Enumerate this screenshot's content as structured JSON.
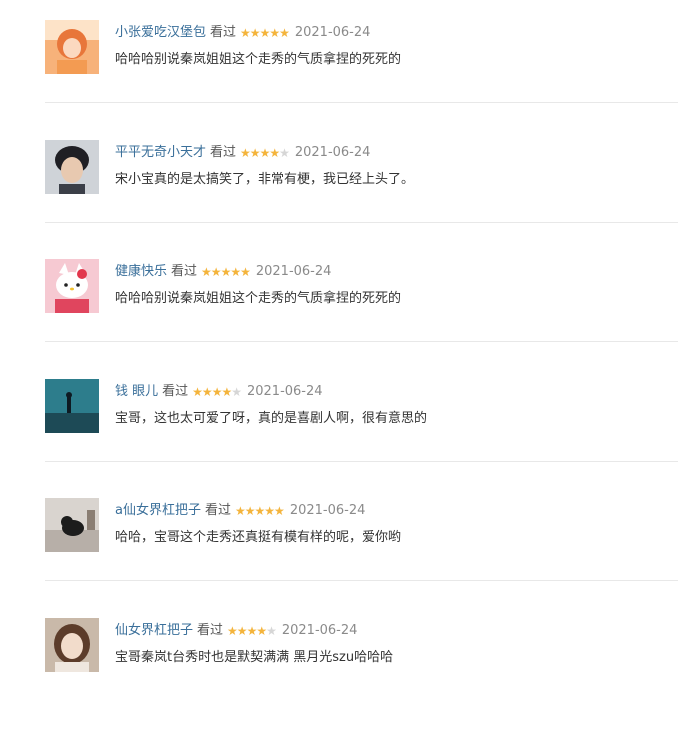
{
  "reviews": [
    {
      "username": "小张爱吃汉堡包",
      "action": "看过",
      "rating": 5,
      "date": "2021-06-24",
      "comment": "哈哈哈别说秦岚姐姐这个走秀的气质拿捏的死死的",
      "avatar": "orange-hair-girl"
    },
    {
      "username": "平平无奇小天才",
      "action": "看过",
      "rating": 4,
      "date": "2021-06-24",
      "comment": "宋小宝真的是太搞笑了，非常有梗，我已经上头了。",
      "avatar": "dark-hair-boy"
    },
    {
      "username": "健康快乐",
      "action": "看过",
      "rating": 5,
      "date": "2021-06-24",
      "comment": "哈哈哈别说秦岚姐姐这个走秀的气质拿捏的死死的",
      "avatar": "hello-kitty"
    },
    {
      "username": "钱 眼儿",
      "action": "看过",
      "rating": 4,
      "date": "2021-06-24",
      "comment": "宝哥，这也太可爱了呀，真的是喜剧人啊，很有意思的",
      "avatar": "teal-landscape"
    },
    {
      "username": "a仙女界杠把子",
      "action": "看过",
      "rating": 5,
      "date": "2021-06-24",
      "comment": "哈哈，宝哥这个走秀还真挺有模有样的呢，爱你哟",
      "avatar": "cat-on-table"
    },
    {
      "username": "仙女界杠把子",
      "action": "看过",
      "rating": 4,
      "date": "2021-06-24",
      "comment": "宝哥秦岚t台秀时也是默契满满 黑月光szu哈哈哈",
      "avatar": "girl-portrait"
    }
  ]
}
